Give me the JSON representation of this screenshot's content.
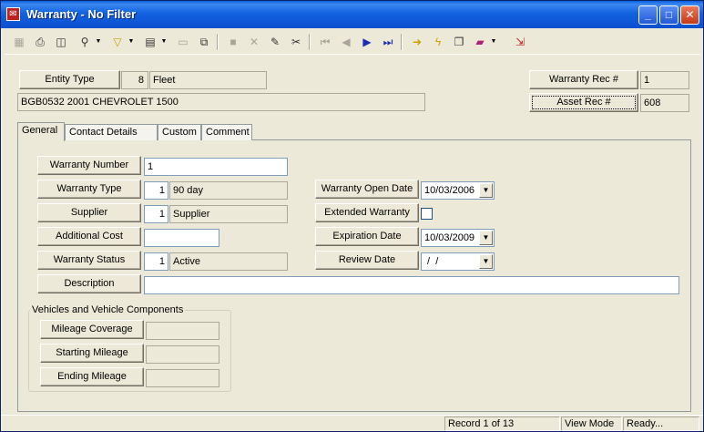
{
  "window": {
    "title": "Warranty - No Filter",
    "minimize": "_",
    "maximize": "□",
    "close": "✕"
  },
  "header": {
    "entity_type_label": "Entity Type",
    "entity_type_code": "8",
    "entity_type_value": "Fleet",
    "asset_description": "BGB0532 2001 CHEVROLET 1500",
    "warranty_rec_label": "Warranty Rec #",
    "warranty_rec_value": "1",
    "asset_rec_label": "Asset Rec #",
    "asset_rec_value": "608"
  },
  "tabs": [
    "General",
    "Contact Details",
    "Custom",
    "Comment"
  ],
  "form": {
    "warranty_number_label": "Warranty Number",
    "warranty_number_value": "1",
    "warranty_type_label": "Warranty Type",
    "warranty_type_code": "1",
    "warranty_type_value": "90 day",
    "supplier_label": "Supplier",
    "supplier_code": "1",
    "supplier_value": "Supplier",
    "additional_cost_label": "Additional Cost",
    "additional_cost_value": "",
    "warranty_status_label": "Warranty Status",
    "warranty_status_code": "1",
    "warranty_status_value": "Active",
    "description_label": "Description",
    "description_value": "",
    "warranty_open_date_label": "Warranty Open Date",
    "warranty_open_date_value": "10/03/2006",
    "extended_warranty_label": "Extended Warranty",
    "expiration_date_label": "Expiration Date",
    "expiration_date_value": "10/03/2009",
    "review_date_label": "Review Date",
    "review_date_value": " /  /"
  },
  "vehicles": {
    "group_title": "Vehicles and Vehicle Components",
    "mileage_coverage_label": "Mileage Coverage",
    "starting_mileage_label": "Starting Mileage",
    "ending_mileage_label": "Ending Mileage"
  },
  "status": {
    "record": "Record 1 of 13",
    "mode": "View Mode",
    "state": "Ready..."
  },
  "toolbar_icons": [
    "grid-icon",
    "print-icon",
    "preview-icon",
    "search-icon",
    "filter-icon",
    "document-icon",
    "edit-document-icon",
    "copy-icon",
    "save-icon",
    "delete-icon",
    "pencil-icon",
    "cut-icon",
    "first-record-icon",
    "prev-record-icon",
    "next-record-icon",
    "last-record-icon",
    "go-arrow-icon",
    "lightning-icon",
    "windows-icon",
    "book-icon",
    "exit-icon"
  ]
}
